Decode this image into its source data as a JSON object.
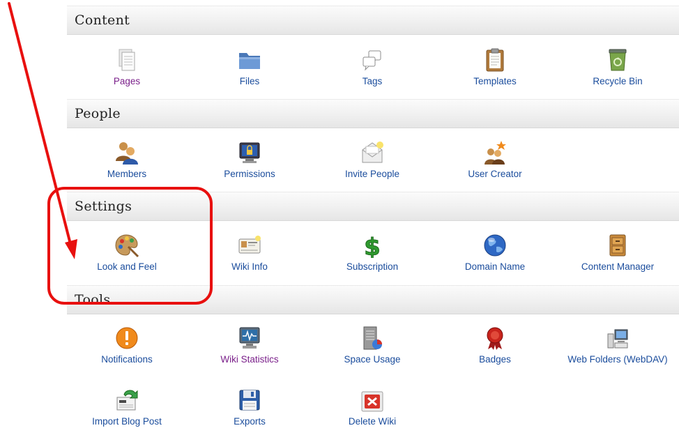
{
  "sections": [
    {
      "title": "Content",
      "items": [
        {
          "label": "Pages",
          "icon": "pages-icon",
          "visited": true
        },
        {
          "label": "Files",
          "icon": "folder-icon",
          "visited": false
        },
        {
          "label": "Tags",
          "icon": "tags-icon",
          "visited": false
        },
        {
          "label": "Templates",
          "icon": "clipboard-icon",
          "visited": false
        },
        {
          "label": "Recycle Bin",
          "icon": "recycle-bin-icon",
          "visited": false
        }
      ]
    },
    {
      "title": "People",
      "items": [
        {
          "label": "Members",
          "icon": "members-icon",
          "visited": false
        },
        {
          "label": "Permissions",
          "icon": "lock-screen-icon",
          "visited": false
        },
        {
          "label": "Invite People",
          "icon": "envelope-icon",
          "visited": false
        },
        {
          "label": "User Creator",
          "icon": "user-creator-icon",
          "visited": false
        }
      ]
    },
    {
      "title": "Settings",
      "items": [
        {
          "label": "Look and Feel",
          "icon": "palette-icon",
          "visited": false
        },
        {
          "label": "Wiki Info",
          "icon": "id-card-icon",
          "visited": false
        },
        {
          "label": "Subscription",
          "icon": "dollar-icon",
          "visited": false
        },
        {
          "label": "Domain Name",
          "icon": "globe-icon",
          "visited": false
        },
        {
          "label": "Content Manager",
          "icon": "cabinet-icon",
          "visited": false
        }
      ]
    },
    {
      "title": "Tools",
      "items": [
        {
          "label": "Notifications",
          "icon": "alert-icon",
          "visited": false
        },
        {
          "label": "Wiki Statistics",
          "icon": "monitor-stats-icon",
          "visited": true
        },
        {
          "label": "Space Usage",
          "icon": "space-usage-icon",
          "visited": false
        },
        {
          "label": "Badges",
          "icon": "badge-icon",
          "visited": false
        },
        {
          "label": "Web Folders (WebDAV)",
          "icon": "web-folders-icon",
          "visited": false
        },
        {
          "label": "Import Blog Post",
          "icon": "import-blog-icon",
          "visited": false
        },
        {
          "label": "Exports",
          "icon": "floppy-icon",
          "visited": false
        },
        {
          "label": "Delete Wiki",
          "icon": "delete-icon",
          "visited": false
        }
      ]
    }
  ],
  "colors": {
    "link": "#1a4c9c",
    "visited_link": "#7a1f8a",
    "annotation": "#e8100f"
  }
}
